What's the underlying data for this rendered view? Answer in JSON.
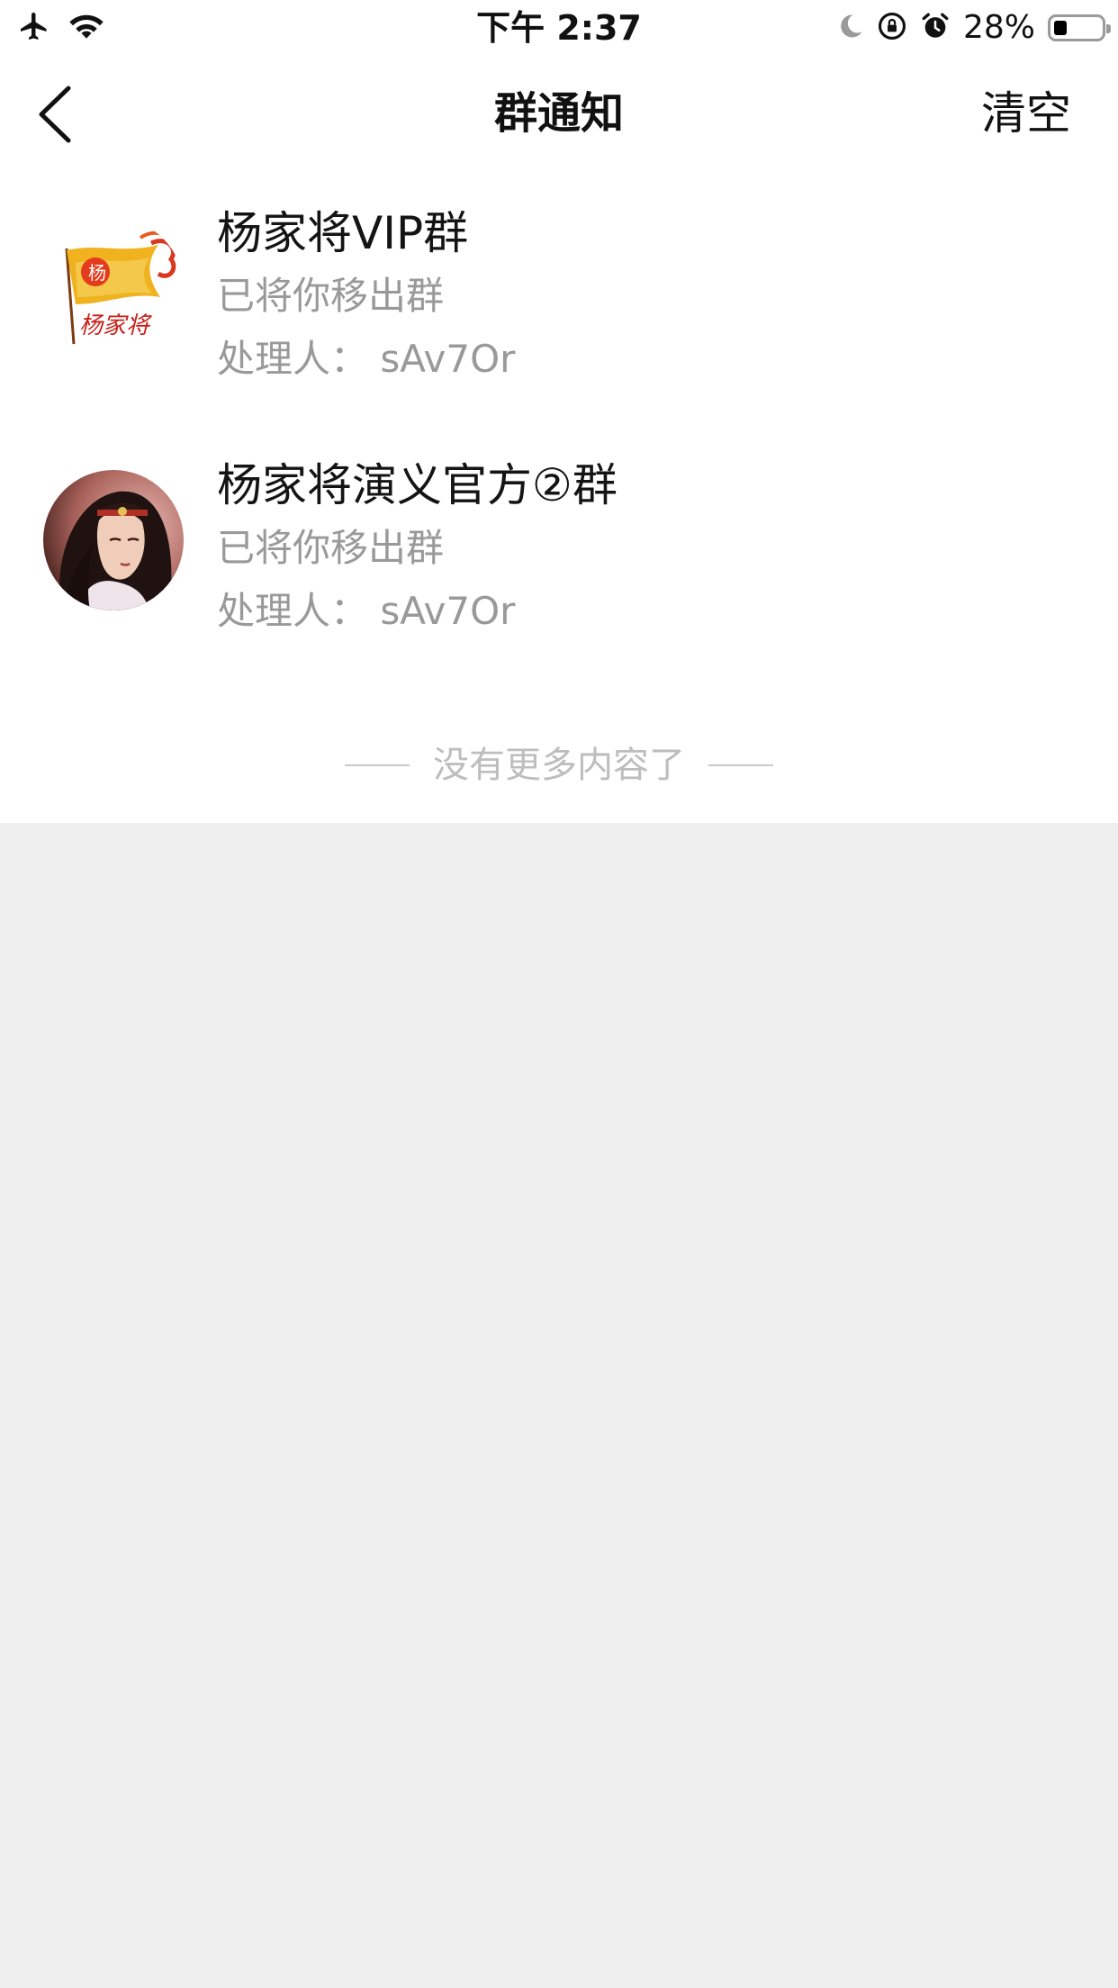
{
  "status_bar": {
    "time": "下午 2:37",
    "battery_percent": "28%",
    "battery_level": 0.28,
    "icons": [
      "airplane-icon",
      "wifi-icon",
      "moon-icon",
      "rotation-lock-icon",
      "alarm-icon",
      "battery-icon"
    ]
  },
  "nav": {
    "title": "群通知",
    "clear_label": "清空",
    "back_icon": "chevron-left-icon"
  },
  "notices": [
    {
      "group_name": "杨家将VIP群",
      "action": "已将你移出群",
      "operator": "处理人： sAv7Or",
      "avatar": "flag-logo"
    },
    {
      "group_name": "杨家将演义官方②群",
      "action": "已将你移出群",
      "operator": "处理人： sAv7Or",
      "avatar": "character-portrait"
    }
  ],
  "footer": {
    "end_text": "没有更多内容了"
  },
  "colors": {
    "page_bg": "#efefef",
    "card_bg": "#ffffff",
    "secondary_text": "#999999",
    "end_text": "#bdbdbd"
  }
}
